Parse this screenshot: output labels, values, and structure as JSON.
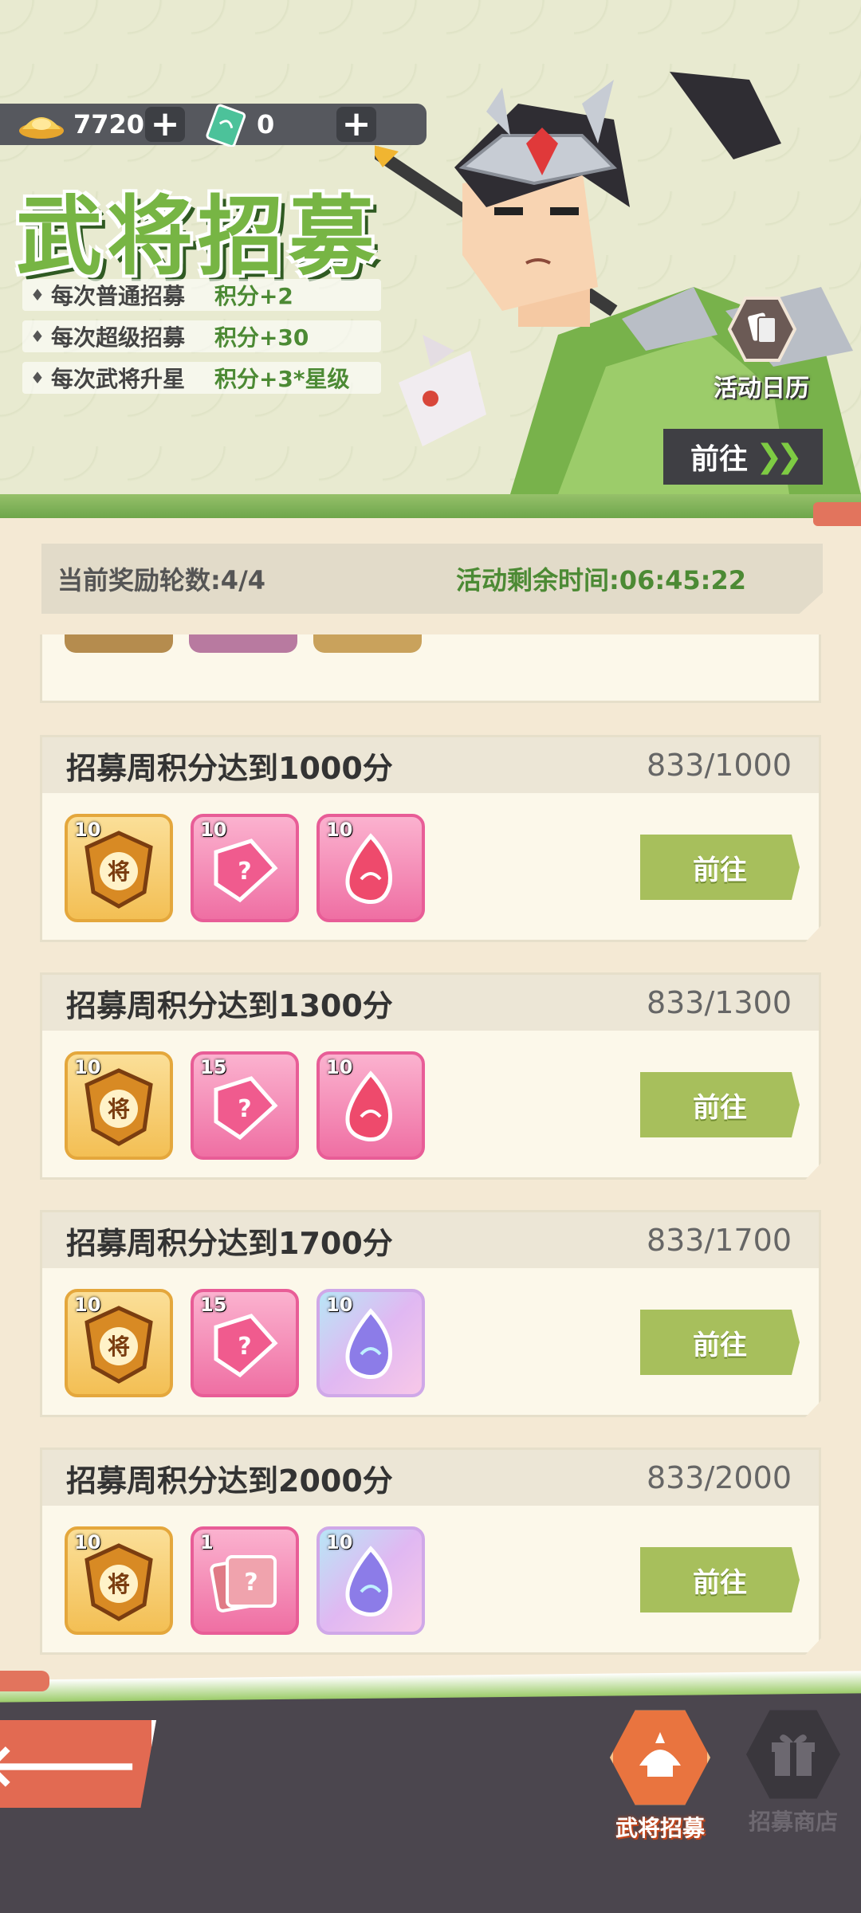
{
  "header": {
    "currency": {
      "gold": "7720",
      "token": "0",
      "plus": "+"
    },
    "title": "武将招募",
    "rules": [
      {
        "name": "每次普通招募",
        "points": "积分+2"
      },
      {
        "name": "每次超级招募",
        "points": "积分+30"
      },
      {
        "name": "每次武将升星",
        "points": "积分+3*星级"
      }
    ],
    "calendar_label": "活动日历",
    "goto_label": "前往"
  },
  "status": {
    "round": "当前奖励轮数:4/4",
    "remaining": "活动剩余时间:06:45:22"
  },
  "tasks": [
    {
      "title": "招募周积分达到1000分",
      "progress": "833/1000",
      "button": "前往",
      "rewards": [
        {
          "type": "gold-token",
          "qty": "10"
        },
        {
          "type": "pink-puzzle",
          "qty": "10"
        },
        {
          "type": "pink-flame",
          "qty": "10"
        }
      ]
    },
    {
      "title": "招募周积分达到1300分",
      "progress": "833/1300",
      "button": "前往",
      "rewards": [
        {
          "type": "gold-token",
          "qty": "10"
        },
        {
          "type": "pink-puzzle",
          "qty": "15"
        },
        {
          "type": "pink-flame",
          "qty": "10"
        }
      ]
    },
    {
      "title": "招募周积分达到1700分",
      "progress": "833/1700",
      "button": "前往",
      "rewards": [
        {
          "type": "gold-token",
          "qty": "10"
        },
        {
          "type": "pink-puzzle",
          "qty": "15"
        },
        {
          "type": "blue-flame",
          "qty": "10"
        }
      ]
    },
    {
      "title": "招募周积分达到2000分",
      "progress": "833/2000",
      "button": "前往",
      "rewards": [
        {
          "type": "gold-token",
          "qty": "10"
        },
        {
          "type": "pink-cards",
          "qty": "1"
        },
        {
          "type": "blue-flame",
          "qty": "10"
        }
      ]
    }
  ],
  "bottom_nav": {
    "back_icon": "back-arrow-icon",
    "items": [
      {
        "label": "武将招募",
        "icon": "recruit-icon",
        "active": true
      },
      {
        "label": "招募商店",
        "icon": "gift-icon",
        "active": false
      }
    ]
  },
  "colors": {
    "accent_green": "#77b544",
    "button_green": "#a7bf5c",
    "back_red": "#e26a52"
  }
}
